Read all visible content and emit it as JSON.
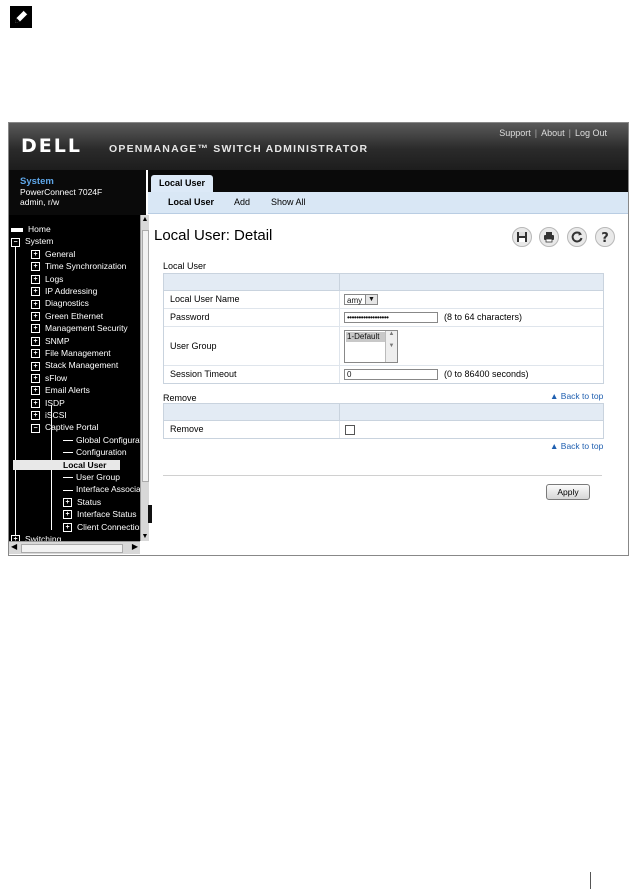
{
  "header": {
    "logo": "DELL",
    "product": "OPENMANAGE™ SWITCH ADMINISTRATOR",
    "links": [
      "Support",
      "About",
      "Log Out"
    ]
  },
  "system": {
    "title": "System",
    "model": "PowerConnect 7024F",
    "user": "admin, r/w"
  },
  "tree": [
    {
      "label": "Home",
      "level": 0,
      "icon": "home"
    },
    {
      "label": "System",
      "level": 0,
      "icon": "minus"
    },
    {
      "label": "General",
      "level": 1,
      "icon": "plus"
    },
    {
      "label": "Time Synchronization",
      "level": 1,
      "icon": "plus"
    },
    {
      "label": "Logs",
      "level": 1,
      "icon": "plus"
    },
    {
      "label": "IP Addressing",
      "level": 1,
      "icon": "plus"
    },
    {
      "label": "Diagnostics",
      "level": 1,
      "icon": "plus"
    },
    {
      "label": "Green Ethernet",
      "level": 1,
      "icon": "plus"
    },
    {
      "label": "Management Security",
      "level": 1,
      "icon": "plus"
    },
    {
      "label": "SNMP",
      "level": 1,
      "icon": "plus"
    },
    {
      "label": "File Management",
      "level": 1,
      "icon": "plus"
    },
    {
      "label": "Stack Management",
      "level": 1,
      "icon": "plus"
    },
    {
      "label": "sFlow",
      "level": 1,
      "icon": "plus"
    },
    {
      "label": "Email Alerts",
      "level": 1,
      "icon": "plus"
    },
    {
      "label": "ISDP",
      "level": 1,
      "icon": "plus"
    },
    {
      "label": "iSCSI",
      "level": 1,
      "icon": "plus"
    },
    {
      "label": "Captive Portal",
      "level": 1,
      "icon": "minus"
    },
    {
      "label": "Global Configuration",
      "level": 2,
      "icon": "none"
    },
    {
      "label": "Configuration",
      "level": 2,
      "icon": "none"
    },
    {
      "label": "Local User",
      "level": 2,
      "icon": "none",
      "selected": true
    },
    {
      "label": "User Group",
      "level": 2,
      "icon": "none"
    },
    {
      "label": "Interface Association",
      "level": 2,
      "icon": "none"
    },
    {
      "label": "Status",
      "level": 2,
      "icon": "plus"
    },
    {
      "label": "Interface Status",
      "level": 2,
      "icon": "plus"
    },
    {
      "label": "Client Connection",
      "level": 2,
      "icon": "plus"
    },
    {
      "label": "Switching",
      "level": 0,
      "icon": "plus"
    }
  ],
  "tabs": {
    "active": "Local User",
    "subnav": [
      "Local User",
      "Add",
      "Show All"
    ]
  },
  "page": {
    "title": "Local User: Detail",
    "tools": [
      "save-icon",
      "print-icon",
      "refresh-icon",
      "help-icon"
    ]
  },
  "local_user": {
    "section_label": "Local User",
    "name_label": "Local User Name",
    "name_value": "amy",
    "password_label": "Password",
    "password_value": "••••••••••••••••••",
    "password_hint": "(8 to 64 characters)",
    "group_label": "User Group",
    "group_option": "1-Default",
    "timeout_label": "Session Timeout",
    "timeout_value": "0",
    "timeout_hint": "(0 to 86400 seconds)"
  },
  "remove": {
    "section_label": "Remove",
    "row_label": "Remove"
  },
  "back_to_top": "▲ Back to top",
  "apply_label": "Apply"
}
